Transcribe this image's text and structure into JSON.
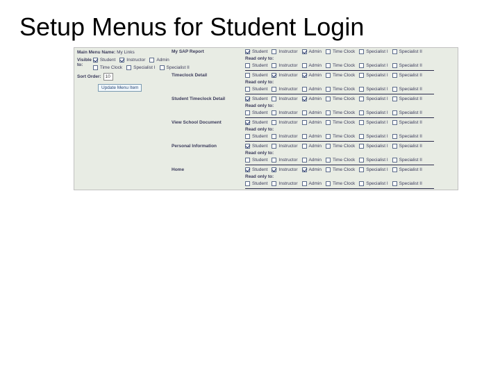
{
  "slide_title": "Setup Menus for Student Login",
  "left_panel": {
    "main_menu_label": "Main Menu Name:",
    "main_menu_name": "My Links",
    "visible_to_label": "Visible to:",
    "sort_order_label": "Sort Order:",
    "sort_order_value": "10",
    "update_button": "Update Menu Item",
    "visible_row1": [
      {
        "label": "Student",
        "checked": true
      },
      {
        "label": "Instructor",
        "checked": true
      },
      {
        "label": "Admin",
        "checked": false
      }
    ],
    "visible_row2": [
      {
        "label": "Time Clock",
        "checked": false
      },
      {
        "label": "Specialist I",
        "checked": false
      },
      {
        "label": "Specialist II",
        "checked": false
      }
    ]
  },
  "role_labels": [
    "Student",
    "Instructor",
    "Admin",
    "Time Clock",
    "Specialist I",
    "Specialist II"
  ],
  "read_only_label": "Read only to:",
  "sections": [
    {
      "name": "My SAP Report",
      "visible": [
        true,
        false,
        true,
        false,
        false,
        false
      ],
      "readonly": [
        false,
        false,
        false,
        false,
        false,
        false
      ]
    },
    {
      "name": "Timeclock Detail",
      "visible": [
        false,
        true,
        true,
        false,
        false,
        false
      ],
      "readonly": [
        false,
        false,
        false,
        false,
        false,
        false
      ]
    },
    {
      "name": "Student Timeclock Detail",
      "visible": [
        true,
        false,
        true,
        false,
        false,
        false
      ],
      "readonly": [
        false,
        false,
        false,
        false,
        false,
        false
      ]
    },
    {
      "name": "View School Document",
      "visible": [
        true,
        false,
        false,
        false,
        false,
        false
      ],
      "readonly": [
        false,
        false,
        false,
        false,
        false,
        false
      ]
    },
    {
      "name": "Personal Information",
      "visible": [
        true,
        false,
        false,
        false,
        false,
        false
      ],
      "readonly": [
        false,
        false,
        false,
        false,
        false,
        false
      ]
    },
    {
      "name": "Home",
      "visible": [
        true,
        true,
        true,
        false,
        false,
        false
      ],
      "readonly": [
        false,
        false,
        false,
        false,
        false,
        false
      ]
    }
  ]
}
